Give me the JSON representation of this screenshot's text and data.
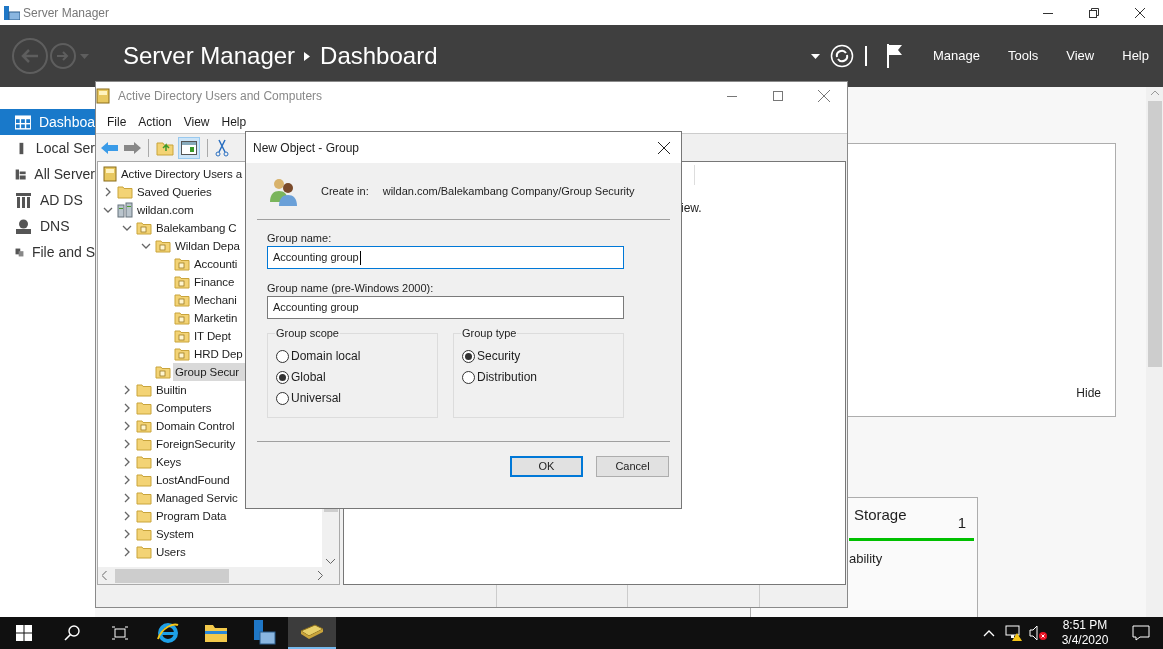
{
  "window": {
    "title": "Server Manager"
  },
  "header": {
    "app": "Server Manager",
    "page": "Dashboard",
    "menu": [
      "Manage",
      "Tools",
      "View",
      "Help"
    ]
  },
  "sidebar": {
    "items": [
      {
        "label": "Dashboa",
        "kind": "dashboard",
        "selected": true
      },
      {
        "label": "Local Ser",
        "kind": "server",
        "selected": false
      },
      {
        "label": "All Server",
        "kind": "servers",
        "selected": false
      },
      {
        "label": "AD DS",
        "kind": "adds",
        "selected": false
      },
      {
        "label": "DNS",
        "kind": "dns",
        "selected": false
      },
      {
        "label": "File and S",
        "kind": "files",
        "selected": false
      }
    ]
  },
  "dashboard": {
    "hide_link": "Hide",
    "tile": {
      "title": "Storage",
      "count": "1",
      "status": "ability"
    }
  },
  "aduc": {
    "title": "Active Directory Users and Computers",
    "menu": [
      "File",
      "Action",
      "View",
      "Help"
    ],
    "details_text": "iew.",
    "tree": [
      {
        "label": "Active Directory Users a",
        "kind": "root",
        "selected": false,
        "children": [
          {
            "label": "Saved Queries",
            "kind": "folder",
            "expanded": false,
            "selected": false
          },
          {
            "label": "wildan.com",
            "kind": "domain",
            "expanded": true,
            "selected": false,
            "children": [
              {
                "label": "Balekambang C",
                "kind": "ou",
                "expanded": true,
                "selected": false,
                "children": [
                  {
                    "label": "Wildan Depa",
                    "kind": "ou",
                    "expanded": true,
                    "selected": false,
                    "children": [
                      {
                        "label": "Accounti",
                        "kind": "ou",
                        "selected": false
                      },
                      {
                        "label": "Finance",
                        "kind": "ou",
                        "selected": false
                      },
                      {
                        "label": "Mechani",
                        "kind": "ou",
                        "selected": false
                      },
                      {
                        "label": "Marketin",
                        "kind": "ou",
                        "selected": false
                      },
                      {
                        "label": "IT Dept",
                        "kind": "ou",
                        "selected": false
                      },
                      {
                        "label": "HRD Dep",
                        "kind": "ou",
                        "selected": false
                      }
                    ]
                  },
                  {
                    "label": "Group Secur",
                    "kind": "ou",
                    "selected": true
                  }
                ]
              },
              {
                "label": "Builtin",
                "kind": "folder",
                "expanded": false,
                "selected": false
              },
              {
                "label": "Computers",
                "kind": "folder",
                "expanded": false,
                "selected": false
              },
              {
                "label": "Domain Control",
                "kind": "ou",
                "expanded": false,
                "selected": false
              },
              {
                "label": "ForeignSecurity",
                "kind": "folder",
                "expanded": false,
                "selected": false
              },
              {
                "label": "Keys",
                "kind": "folder",
                "expanded": false,
                "selected": false
              },
              {
                "label": "LostAndFound",
                "kind": "folder",
                "expanded": false,
                "selected": false
              },
              {
                "label": "Managed Servic",
                "kind": "folder",
                "expanded": false,
                "selected": false
              },
              {
                "label": "Program Data",
                "kind": "folder",
                "expanded": false,
                "selected": false
              },
              {
                "label": "System",
                "kind": "folder",
                "expanded": false,
                "selected": false
              },
              {
                "label": "Users",
                "kind": "folder",
                "expanded": false,
                "selected": false
              }
            ]
          }
        ]
      }
    ]
  },
  "dialog": {
    "title": "New Object - Group",
    "create_in_label": "Create in:",
    "create_in_path": "wildan.com/Balekambang Company/Group Security",
    "fields": [
      {
        "label": "Group name:",
        "value": "Accounting group",
        "focused": true
      },
      {
        "label": "Group name (pre-Windows 2000):",
        "value": "Accounting group",
        "focused": false
      }
    ],
    "groups": [
      {
        "title": "Group scope",
        "options": [
          {
            "label": "Domain local",
            "selected": false
          },
          {
            "label": "Global",
            "selected": true
          },
          {
            "label": "Universal",
            "selected": false
          }
        ]
      },
      {
        "title": "Group type",
        "options": [
          {
            "label": "Security",
            "selected": true
          },
          {
            "label": "Distribution",
            "selected": false
          }
        ]
      }
    ],
    "buttons": [
      {
        "label": "OK",
        "default": true
      },
      {
        "label": "Cancel",
        "default": false
      }
    ]
  },
  "taskbar": {
    "apps": [
      {
        "kind": "ie",
        "selected": false
      },
      {
        "kind": "explorer",
        "selected": false
      },
      {
        "kind": "servermanager",
        "selected": false
      },
      {
        "kind": "aduc",
        "selected": true
      }
    ],
    "time": "8:51 PM",
    "date": "3/4/2020"
  }
}
